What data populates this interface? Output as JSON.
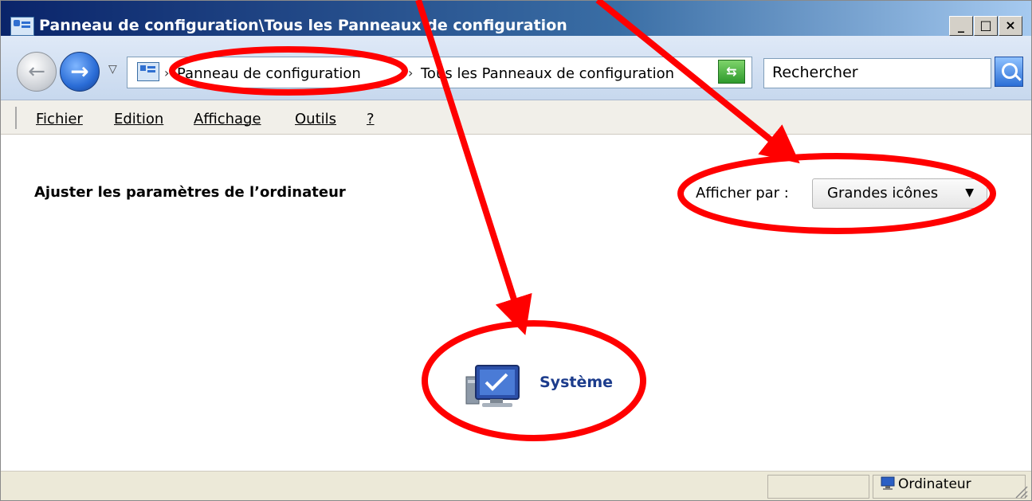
{
  "window": {
    "title": "Panneau de configuration\\Tous les Panneaux de configuration",
    "controls": {
      "minimize": "_",
      "maximize": "□",
      "close": "×"
    }
  },
  "address": {
    "crumbs": [
      "Panneau de configuration",
      "Tous les Panneaux de configuration"
    ],
    "search_placeholder": "Rechercher"
  },
  "menu": {
    "items": [
      "Fichier",
      "Edition",
      "Affichage",
      "Outils",
      "?"
    ]
  },
  "content": {
    "heading": "Ajuster les paramètres de l’ordinateur",
    "view_by_label": "Afficher par :",
    "view_by_value": "Grandes icônes",
    "items": [
      {
        "label": "Système",
        "icon": "system-monitor-icon"
      }
    ]
  },
  "status": {
    "label": "Ordinateur",
    "icon": "computer-icon"
  },
  "annotations": {
    "color": "#ff0000",
    "kind": [
      "ellipse",
      "arrow"
    ]
  }
}
